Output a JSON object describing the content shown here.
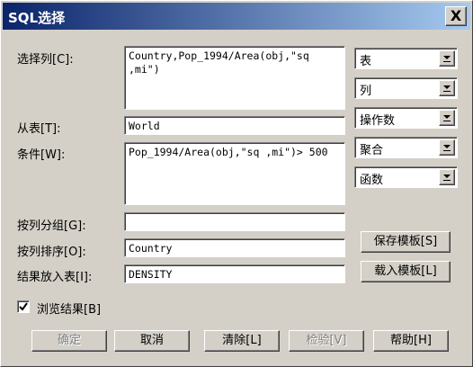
{
  "window": {
    "title": "SQL选择",
    "close_glyph": "X"
  },
  "labels": {
    "columns": "选择列[C]:",
    "from_table": "从表[T]:",
    "condition": "条件[W]:",
    "group_by": "按列分组[G]:",
    "order_by": "按列排序[O]:",
    "result_table": "结果放入表[I]:"
  },
  "fields": {
    "columns": "Country,Pop_1994/Area(obj,\"sq\n,mi\")",
    "from_table": "World",
    "condition": "Pop_1994/Area(obj,\"sq ,mi\")> 500",
    "group_by": "",
    "order_by": "Country",
    "result_table": "DENSITY"
  },
  "combos": [
    {
      "label": "表",
      "icon": "underline-down-arrow-icon"
    },
    {
      "label": "列",
      "icon": "underline-down-arrow-icon"
    },
    {
      "label": "操作数",
      "icon": "underline-down-arrow-icon"
    },
    {
      "label": "聚合",
      "icon": "underline-down-arrow-icon"
    },
    {
      "label": "函数",
      "icon": "underline-down-arrow-icon"
    }
  ],
  "side_buttons": {
    "save_template": "保存模板[S]",
    "load_template": "载入模板[L]"
  },
  "checkbox": {
    "label": "浏览结果[B]",
    "checked": true
  },
  "bottom_buttons": {
    "ok": "确定",
    "cancel": "取消",
    "clear": "清除[L]",
    "verify": "检验[V]",
    "help": "帮助[H]"
  }
}
